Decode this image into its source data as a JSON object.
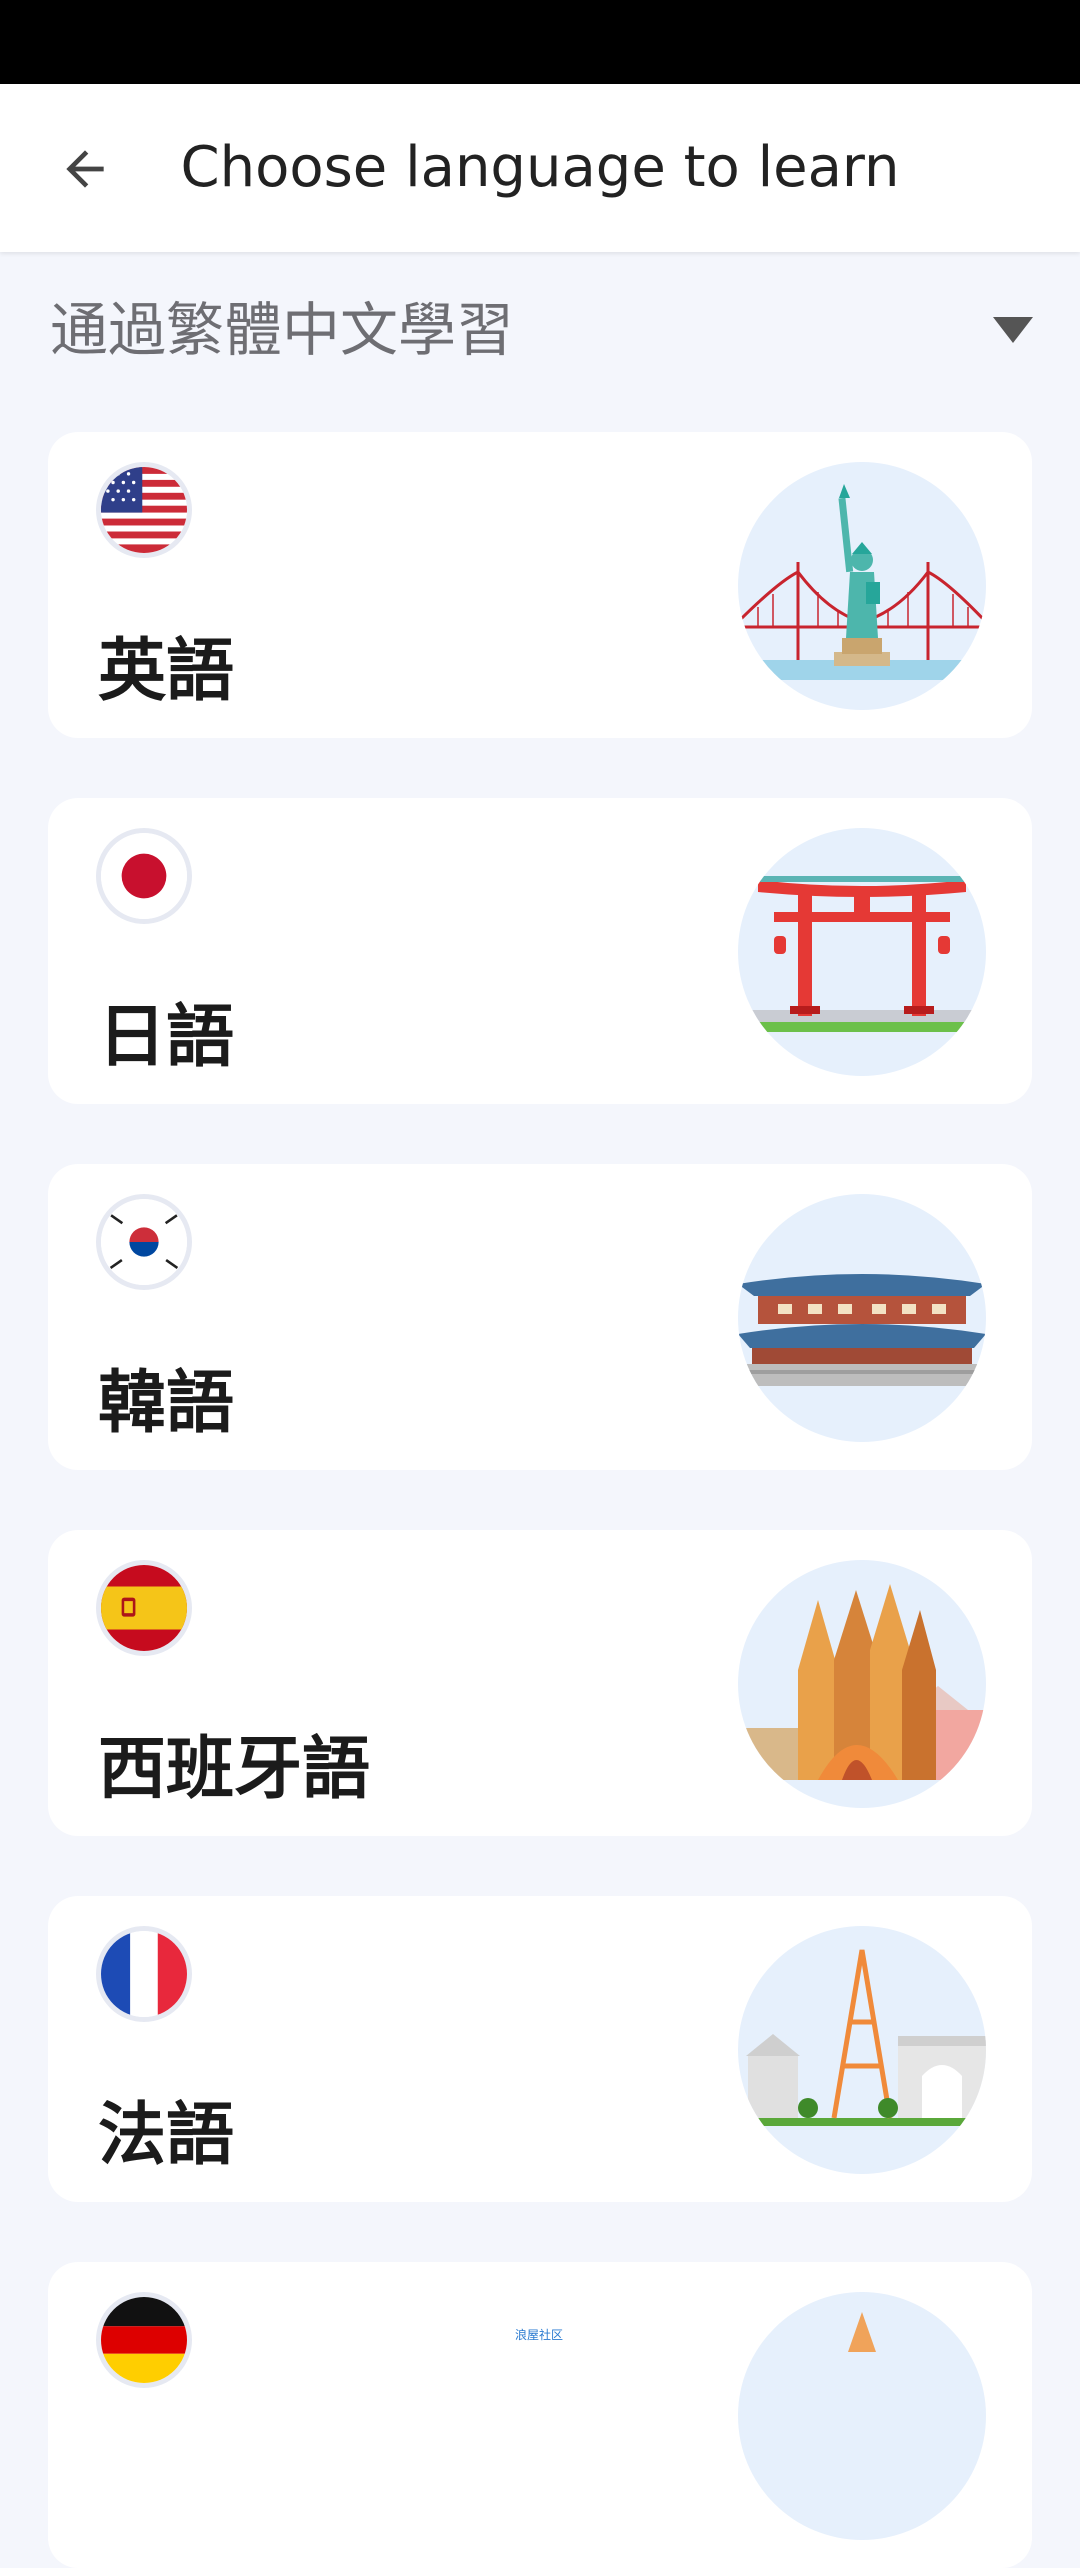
{
  "header": {
    "title": "Choose language to learn"
  },
  "source_language": {
    "label": "通過繁體中文學習"
  },
  "languages": [
    {
      "label": "英語",
      "flag": "us-flag-icon",
      "scene": "statue-of-liberty-bridge"
    },
    {
      "label": "日語",
      "flag": "japan-flag-icon",
      "scene": "torii-gate"
    },
    {
      "label": "韓語",
      "flag": "korea-flag-icon",
      "scene": "korean-palace"
    },
    {
      "label": "西班牙語",
      "flag": "spain-flag-icon",
      "scene": "sagrada-familia"
    },
    {
      "label": "法語",
      "flag": "france-flag-icon",
      "scene": "eiffel-tower"
    },
    {
      "label": "",
      "flag": "germany-flag-icon",
      "scene": "german-landmark"
    }
  ],
  "watermark": "浪屋社区",
  "colors": {
    "background": "#f4f6fc",
    "card": "#ffffff",
    "scene_bg": "#e6f0fc"
  }
}
